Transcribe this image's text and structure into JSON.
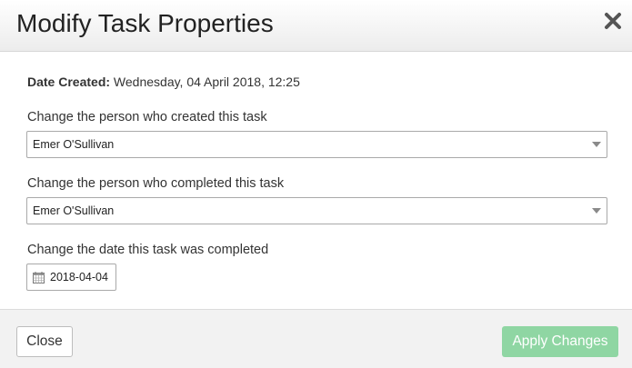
{
  "dialog": {
    "title": "Modify Task Properties"
  },
  "body": {
    "date_created_label": "Date Created:",
    "date_created_value": "Wednesday, 04 April 2018, 12:25",
    "created_by": {
      "label": "Change the person who created this task",
      "selected": "Emer O'Sullivan"
    },
    "completed_by": {
      "label": "Change the person who completed this task",
      "selected": "Emer O'Sullivan"
    },
    "completed_date": {
      "label": "Change the date this task was completed",
      "value": "2018-04-04"
    }
  },
  "footer": {
    "close_label": "Close",
    "apply_label": "Apply Changes"
  },
  "colors": {
    "apply_button": "#8fd6a3",
    "header_bg": "#ececec",
    "footer_bg": "#f2f2f2"
  },
  "icons": {
    "close": "close-icon",
    "calendar": "calendar-icon",
    "dropdown": "chevron-down-icon"
  }
}
